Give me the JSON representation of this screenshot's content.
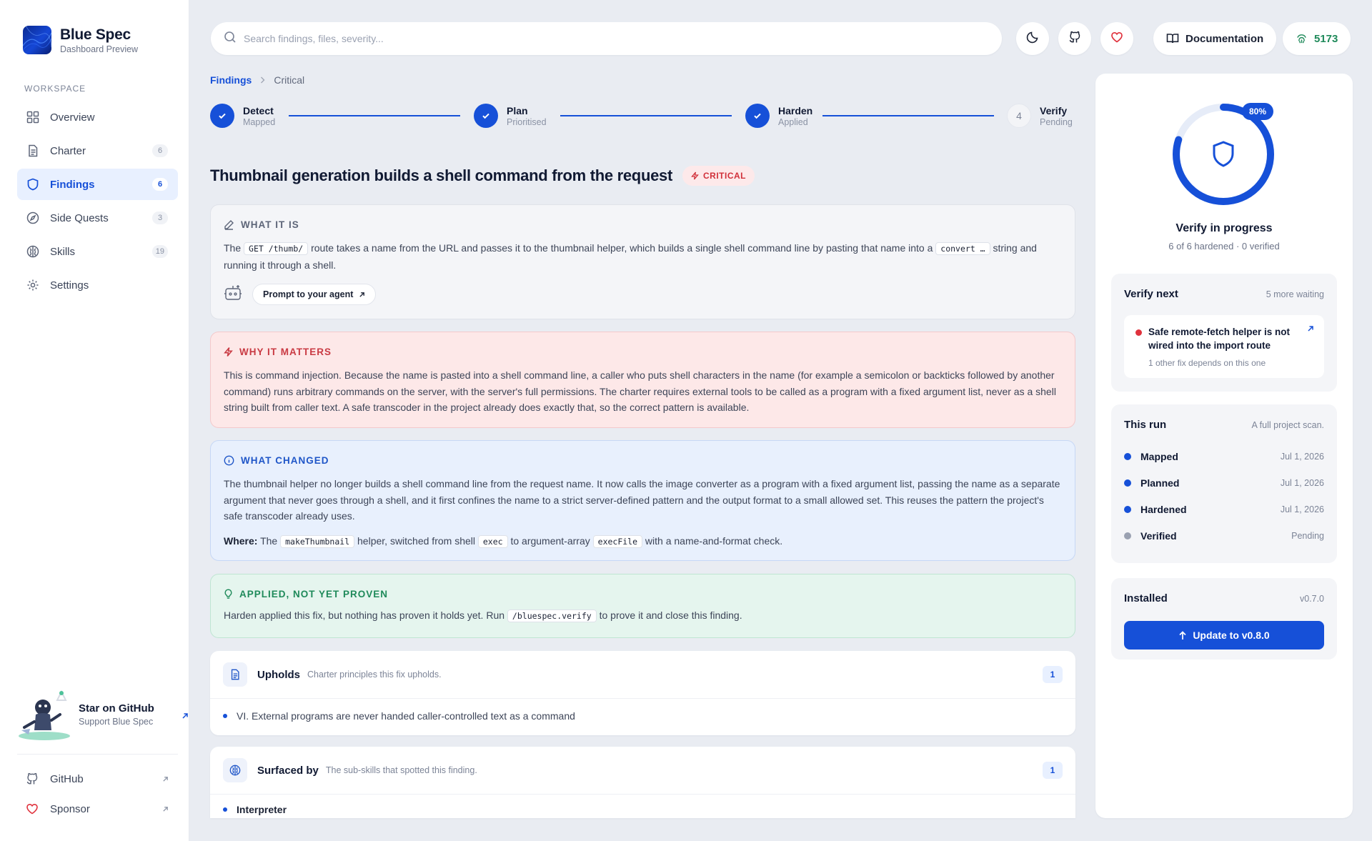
{
  "brand": {
    "name": "Blue Spec",
    "subtitle": "Dashboard Preview"
  },
  "sidebar": {
    "section_label": "WORKSPACE",
    "items": [
      {
        "label": "Overview",
        "count": "",
        "icon": "grid-icon",
        "active": false
      },
      {
        "label": "Charter",
        "count": "6",
        "icon": "document-icon",
        "active": false
      },
      {
        "label": "Findings",
        "count": "6",
        "icon": "shield-icon",
        "active": true
      },
      {
        "label": "Side Quests",
        "count": "3",
        "icon": "compass-icon",
        "active": false
      },
      {
        "label": "Skills",
        "count": "19",
        "icon": "brain-icon",
        "active": false
      },
      {
        "label": "Settings",
        "count": "",
        "icon": "gear-icon",
        "active": false
      }
    ],
    "star": {
      "title": "Star on GitHub",
      "subtitle": "Support Blue Spec"
    },
    "links": [
      {
        "label": "GitHub",
        "icon": "github-icon"
      },
      {
        "label": "Sponsor",
        "icon": "heart-icon"
      }
    ]
  },
  "topbar": {
    "search_placeholder": "Search findings, files, severity...",
    "docs_label": "Documentation",
    "stars_count": "5173"
  },
  "breadcrumb": {
    "root": "Findings",
    "current": "Critical"
  },
  "steps": [
    {
      "title": "Detect",
      "status": "Mapped",
      "done": true
    },
    {
      "title": "Plan",
      "status": "Prioritised",
      "done": true
    },
    {
      "title": "Harden",
      "status": "Applied",
      "done": true
    },
    {
      "number": "4",
      "title": "Verify",
      "status": "Pending",
      "done": false
    }
  ],
  "finding": {
    "title": "Thumbnail generation builds a shell command from the request",
    "severity": "CRITICAL",
    "what_it_is": {
      "heading": "WHAT IT IS",
      "t1": "The",
      "code1": "GET /thumb/",
      "t2": "route takes a name from the URL and passes it to the thumbnail helper, which builds a single shell command line by pasting that name into a",
      "code2": "convert …",
      "t3": "string and running it through a shell.",
      "prompt_label": "Prompt to your agent"
    },
    "why_it_matters": {
      "heading": "WHY IT MATTERS",
      "text": "This is command injection. Because the name is pasted into a shell command line, a caller who puts shell characters in the name (for example a semicolon or backticks followed by another command) runs arbitrary commands on the server, with the server's full permissions. The charter requires external tools to be called as a program with a fixed argument list, never as a shell string built from caller text. A safe transcoder in the project already does exactly that, so the correct pattern is available."
    },
    "what_changed": {
      "heading": "WHAT CHANGED",
      "text": "The thumbnail helper no longer builds a shell command line from the request name. It now calls the image converter as a program with a fixed argument list, passing the name as a separate argument that never goes through a shell, and it first confines the name to a strict server-defined pattern and the output format to a small allowed set. This reuses the pattern the project's safe transcoder already uses.",
      "where_label": "Where:",
      "w1": "The",
      "wcode1": "makeThumbnail",
      "w2": "helper, switched from shell",
      "wcode2": "exec",
      "w3": "to argument-array",
      "wcode3": "execFile",
      "w4": "with a name-and-format check."
    },
    "applied": {
      "heading": "APPLIED, NOT YET PROVEN",
      "t1": "Harden applied this fix, but nothing has proven it holds yet. Run",
      "code": "/bluespec.verify",
      "t2": "to prove it and close this finding."
    },
    "upholds": {
      "title": "Upholds",
      "subtitle": "Charter principles this fix upholds.",
      "count": "1",
      "items": [
        "VI. External programs are never handed caller-controlled text as a command"
      ]
    },
    "surfaced_by": {
      "title": "Surfaced by",
      "subtitle": "The sub-skills that spotted this finding.",
      "count": "1",
      "items": [
        "Interpreter"
      ]
    }
  },
  "progress": {
    "percent_label": "80%",
    "percent": 80,
    "title": "Verify in progress",
    "subtitle": "6 of 6 hardened · 0 verified"
  },
  "verify_next": {
    "title": "Verify next",
    "waiting": "5 more waiting",
    "item_title": "Safe remote-fetch helper is not wired into the import route",
    "item_sub": "1 other fix depends on this one"
  },
  "this_run": {
    "title": "This run",
    "subtitle": "A full project scan.",
    "rows": [
      {
        "name": "Mapped",
        "value": "Jul 1, 2026",
        "color": "#1650d8"
      },
      {
        "name": "Planned",
        "value": "Jul 1, 2026",
        "color": "#1650d8"
      },
      {
        "name": "Hardened",
        "value": "Jul 1, 2026",
        "color": "#1650d8"
      },
      {
        "name": "Verified",
        "value": "Pending",
        "color": "#9aa1b1"
      }
    ]
  },
  "installed": {
    "title": "Installed",
    "version": "v0.7.0",
    "update_label": "Update to v0.8.0"
  },
  "colors": {
    "accent": "#1650d8",
    "critical": "#d1313b",
    "success": "#1f8a5a"
  }
}
